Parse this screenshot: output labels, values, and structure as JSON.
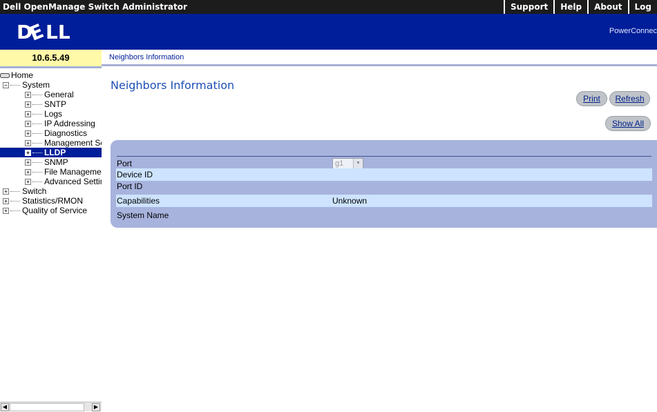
{
  "window": {
    "title": "Dell OpenManage Switch Administrator",
    "menu": [
      "Support",
      "Help",
      "About",
      "Log"
    ]
  },
  "banner": {
    "logo": "DELL",
    "product": "PowerConnec"
  },
  "sidebar": {
    "ip": "10.6.5.49",
    "tree": {
      "home": "Home",
      "system": "System",
      "system_items": [
        "General",
        "SNTP",
        "Logs",
        "IP Addressing",
        "Diagnostics",
        "Management Se",
        "LLDP",
        "SNMP",
        "File Managemer",
        "Advanced Settin"
      ],
      "top_items": [
        "Switch",
        "Statistics/RMON",
        "Quality of Service"
      ]
    },
    "selected": "LLDP"
  },
  "breadcrumb": "Neighbors Information",
  "page": {
    "title": "Neighbors Information",
    "print_label": "Print",
    "refresh_label": "Refresh",
    "show_all_label": "Show All"
  },
  "form": {
    "port_label": "Port",
    "port_value": "g1",
    "device_id_label": "Device ID",
    "device_id_value": "",
    "port_id_label": "Port ID",
    "port_id_value": "",
    "capabilities_label": "Capabilities",
    "capabilities_value": "Unknown",
    "system_name_label": "System Name",
    "system_name_value": ""
  },
  "colors": {
    "banner": "#001e99",
    "ip_box": "#fff9a8",
    "panel": "#a7b3dd",
    "row_alt": "#cde3ff",
    "title": "#1e4fb8"
  }
}
